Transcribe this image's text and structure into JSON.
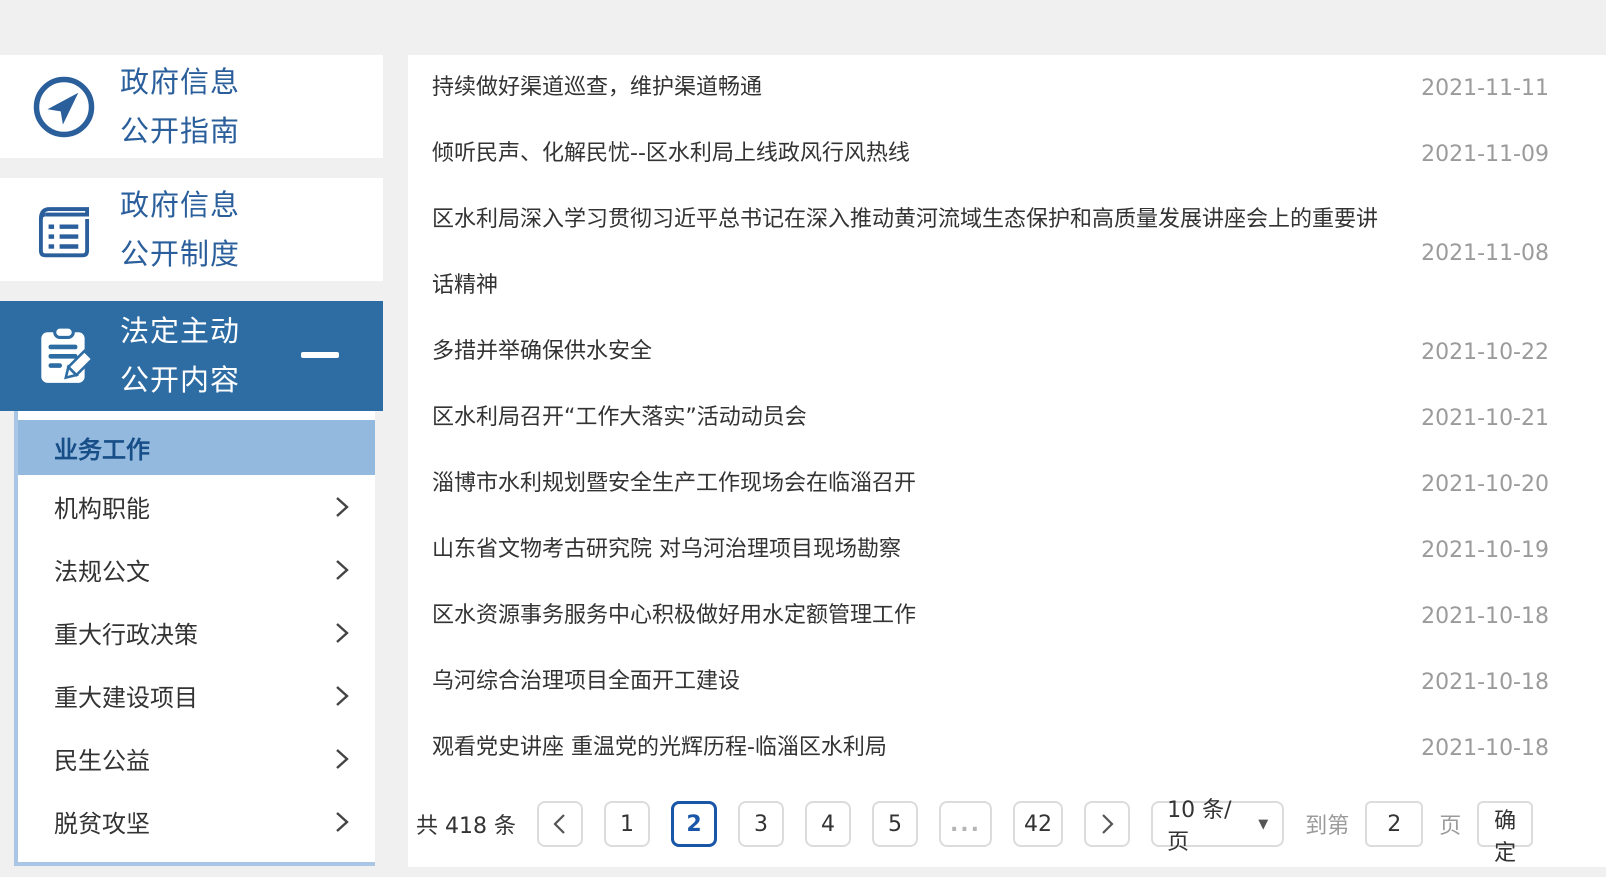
{
  "colors": {
    "primary_blue": "#2E6DA4",
    "sidebar_text_blue": "#2B5F9C",
    "active_item_bg": "#93B9DF",
    "active_item_text": "#174E87",
    "active_page_blue": "#1A56A8",
    "date_gray": "#9B9B9B",
    "page_bg": "#F0F0F0"
  },
  "sidebar": {
    "cards": [
      {
        "line1": "政府信息",
        "line2": "公开指南",
        "icon": "compass-icon"
      },
      {
        "line1": "政府信息",
        "line2": "公开制度",
        "icon": "notebook-icon"
      },
      {
        "line1": "法定主动",
        "line2": "公开内容",
        "icon": "clipboard-pencil-icon",
        "collapse_indicator": "minus-icon",
        "active": true
      }
    ],
    "submenu": {
      "active_item": {
        "label": "业务工作"
      },
      "items": [
        {
          "label": "机构职能",
          "icon": "chevron-right-icon"
        },
        {
          "label": "法规公文",
          "icon": "chevron-right-icon"
        },
        {
          "label": "重大行政决策",
          "icon": "chevron-right-icon"
        },
        {
          "label": "重大建设项目",
          "icon": "chevron-right-icon"
        },
        {
          "label": "民生公益",
          "icon": "chevron-right-icon"
        },
        {
          "label": "脱贫攻坚",
          "icon": "chevron-right-icon"
        }
      ]
    }
  },
  "news_list": [
    {
      "title": "持续做好渠道巡查，维护渠道畅通",
      "date": "2021-11-11"
    },
    {
      "title": "倾听民声、化解民忧--区水利局上线政风行风热线",
      "date": "2021-11-09"
    },
    {
      "title": "区水利局深入学习贯彻习近平总书记在深入推动黄河流域生态保护和高质量发展讲座会上的重要讲话精神",
      "date": "2021-11-08"
    },
    {
      "title": "多措并举确保供水安全",
      "date": "2021-10-22"
    },
    {
      "title": "区水利局召开“工作大落实”活动动员会",
      "date": "2021-10-21"
    },
    {
      "title": "淄博市水利规划暨安全生产工作现场会在临淄召开",
      "date": "2021-10-20"
    },
    {
      "title": "山东省文物考古研究院 对乌河治理项目现场勘察",
      "date": "2021-10-19"
    },
    {
      "title": "区水资源事务服务中心积极做好用水定额管理工作",
      "date": "2021-10-18"
    },
    {
      "title": "乌河综合治理项目全面开工建设",
      "date": "2021-10-18"
    },
    {
      "title": "观看党史讲座 重温党的光辉历程-临淄区水利局",
      "date": "2021-10-18"
    }
  ],
  "pagination": {
    "total_label": "共 418 条",
    "prev_icon": "chevron-left-icon",
    "next_icon": "chevron-right-icon",
    "pages": [
      "1",
      "2",
      "3",
      "4",
      "5",
      "...",
      "42"
    ],
    "active_page": "2",
    "page_size_label": "10 条/页",
    "page_size_caret_icon": "caret-down-icon",
    "goto_prefix": "到第",
    "goto_value": "2",
    "goto_suffix": "页",
    "confirm_label": "确定"
  }
}
